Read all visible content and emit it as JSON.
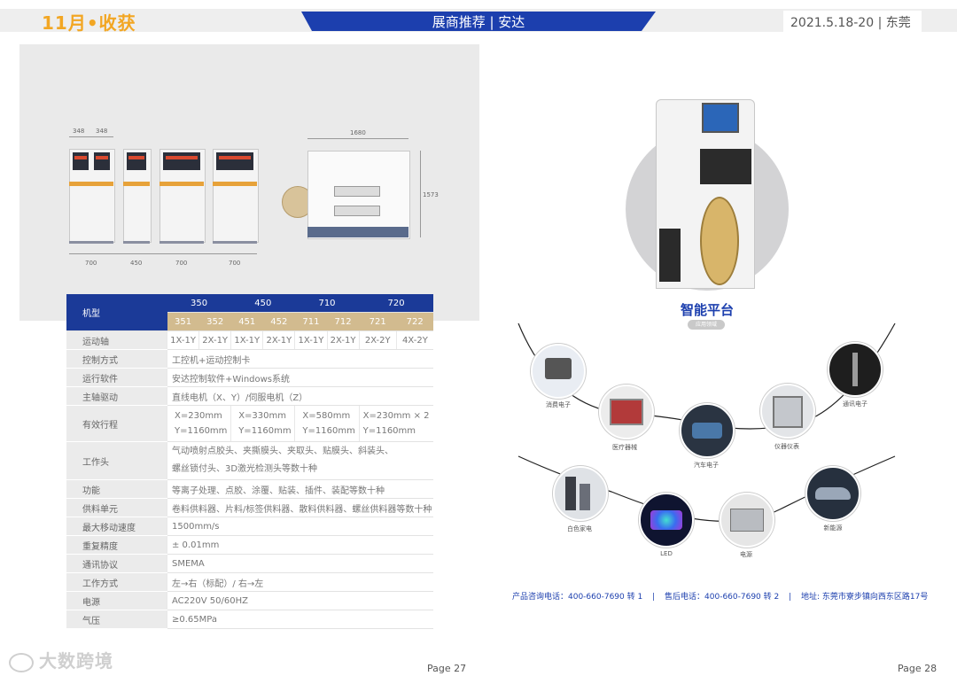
{
  "header": {
    "left_title": "11月•收获",
    "center_title": "展商推荐 | 安达",
    "right_text": "2021.5.18-20 | 东莞"
  },
  "diagram": {
    "top_dims": [
      "348",
      "348"
    ],
    "width_dim": "1680",
    "height_dim": "1573",
    "bottom_dims": [
      "700",
      "450",
      "700",
      "700"
    ]
  },
  "table": {
    "model_label": "机型",
    "groups": [
      "350",
      "450",
      "710",
      "720"
    ],
    "submodels": [
      "351",
      "352",
      "451",
      "452",
      "711",
      "712",
      "721",
      "722"
    ],
    "axis_label": "运动轴",
    "axis_values": [
      "1X-1Y",
      "2X-1Y",
      "1X-1Y",
      "2X-1Y",
      "1X-1Y",
      "2X-1Y",
      "2X-2Y",
      "4X-2Y"
    ],
    "rows_a": [
      {
        "label": "控制方式",
        "value": "工控机+运动控制卡"
      },
      {
        "label": "运行软件",
        "value": "安达控制软件+Windows系统"
      },
      {
        "label": "主轴驱动",
        "value": "直线电机（X、Y）/伺服电机（Z）"
      }
    ],
    "stroke_label": "有效行程",
    "stroke_values": [
      {
        "x": "X=230mm",
        "y": "Y=1160mm"
      },
      {
        "x": "X=330mm",
        "y": "Y=1160mm"
      },
      {
        "x": "X=580mm",
        "y": "Y=1160mm"
      },
      {
        "x": "X=230mm × 2",
        "y": "Y=1160mm"
      }
    ],
    "head_label": "工作头",
    "head_line1": "气动喷射点胶头、夹撕膜头、夹取头、贴膜头、斜装头、",
    "head_line2": "螺丝锁付头、3D激光检测头等数十种",
    "rows_b": [
      {
        "label": "功能",
        "value": "等离子处理、点胶、涂覆、贴装、插件、装配等数十种"
      },
      {
        "label": "供料单元",
        "value": "卷料供料器、片料/标签供料器、散料供料器、螺丝供料器等数十种"
      },
      {
        "label": "最大移动速度",
        "value": "1500mm/s"
      },
      {
        "label": "重复精度",
        "value": "± 0.01mm"
      },
      {
        "label": "通讯协议",
        "value": "SMEMA"
      },
      {
        "label": "工作方式",
        "value": "左→右（标配）/ 右→左"
      },
      {
        "label": "电源",
        "value": "AC220V   50/60HZ"
      },
      {
        "label": "气压",
        "value": "≥0.65MPa"
      }
    ]
  },
  "watermark": "大数跨境",
  "pages": {
    "left": "Page 27",
    "right": "Page 28"
  },
  "platform": {
    "title": "智能平台",
    "tag": "应用领域",
    "apps": [
      {
        "label": "消费电子",
        "icon": "consumer-electronics-icon"
      },
      {
        "label": "医疗器械",
        "icon": "medical-device-icon"
      },
      {
        "label": "汽车电子",
        "icon": "car-electronics-icon"
      },
      {
        "label": "仪器仪表",
        "icon": "instrument-icon"
      },
      {
        "label": "通讯电子",
        "icon": "telecom-tower-icon"
      },
      {
        "label": "白色家电",
        "icon": "home-appliance-icon"
      },
      {
        "label": "LED",
        "icon": "led-icon"
      },
      {
        "label": "电源",
        "icon": "power-supply-icon"
      },
      {
        "label": "新能源",
        "icon": "new-energy-car-icon"
      }
    ]
  },
  "contact": {
    "consult": "产品咨询电话：400-660-7690 转 1",
    "after_sales": "售后电话：400-660-7690 转 2",
    "address": "地址: 东莞市寮步镇向西东区路17号",
    "sep": "|"
  }
}
